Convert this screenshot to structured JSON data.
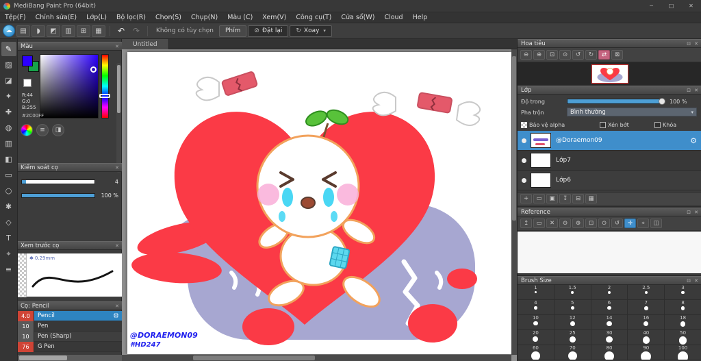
{
  "window": {
    "title": "MediBang Paint Pro (64bit)",
    "minimize_icon": "─",
    "maximize_icon": "□",
    "close_icon": "✕"
  },
  "menu": {
    "items": [
      "Tệp(F)",
      "Chỉnh sửa(E)",
      "Lớp(L)",
      "Bộ lọc(R)",
      "Chọn(S)",
      "Chụp(N)",
      "Màu (C)",
      "Xem(V)",
      "Công cụ(T)",
      "Cửa sổ(W)",
      "Cloud",
      "Help"
    ]
  },
  "toolbar": {
    "icons": [
      {
        "name": "cloud-sync-icon",
        "glyph": "☁",
        "cls": "cloud"
      },
      {
        "name": "new-canvas-icon",
        "glyph": "▤"
      },
      {
        "name": "comment-icon",
        "glyph": "◗"
      },
      {
        "name": "palette-icon",
        "glyph": "◩"
      },
      {
        "name": "panel-layout-icon",
        "glyph": "▥"
      },
      {
        "name": "grid-view-icon",
        "glyph": "⊞"
      },
      {
        "name": "material-icon",
        "glyph": "▦"
      }
    ],
    "undo_icon": "↶",
    "redo_icon": "↷",
    "no_option_label": "Không có tùy chọn",
    "keys_button": "Phím",
    "reset_icon": "⊘",
    "reset_button": "Đặt lại",
    "rotate_icon": "↻",
    "rotate_button": "Xoay",
    "rotate_caret": "▾"
  },
  "tools": [
    {
      "name": "pen-tool",
      "glyph": "✎"
    },
    {
      "name": "eraser-tool",
      "glyph": "▨"
    },
    {
      "name": "selection-pen-tool",
      "glyph": "◪"
    },
    {
      "name": "brush-tool",
      "glyph": "✦"
    },
    {
      "name": "move-tool",
      "glyph": "✚"
    },
    {
      "name": "fill-tool",
      "glyph": "◍"
    },
    {
      "name": "gradient-tool",
      "glyph": "▥"
    },
    {
      "name": "bucket-tool",
      "glyph": "◧"
    },
    {
      "name": "select-rect-tool",
      "glyph": "▭"
    },
    {
      "name": "lasso-tool",
      "glyph": "○"
    },
    {
      "name": "magic-wand-tool",
      "glyph": "✱"
    },
    {
      "name": "shape-tool",
      "glyph": "◇"
    },
    {
      "name": "text-tool",
      "glyph": "T"
    },
    {
      "name": "eyedropper-tool",
      "glyph": "⌖"
    },
    {
      "name": "hand-tool",
      "glyph": "≡"
    }
  ],
  "color_panel": {
    "title": "Màu",
    "r_label": "R:44",
    "g_label": "G:0",
    "b_label": "B:255",
    "hex_value": "#2C00FF",
    "foreground_color": "#2C00FF",
    "background_color": "#17a34a"
  },
  "brush_control": {
    "title": "Kiểm soát cọ",
    "size_value": "4",
    "opacity_value": "100 %"
  },
  "brush_preview": {
    "title": "Xem trước cọ",
    "width_marker": "✱",
    "width_label": "0.29mm"
  },
  "brush_list": {
    "title": "Cọ: Pencil",
    "settings_icon": "⚙",
    "items": [
      {
        "size": "4.0",
        "name": "Pencil",
        "selected": true,
        "red_badge": true
      },
      {
        "size": "10",
        "name": "Pen",
        "selected": false,
        "red_badge": false
      },
      {
        "size": "10",
        "name": "Pen (Sharp)",
        "selected": false,
        "red_badge": false
      },
      {
        "size": "76",
        "name": "G Pen",
        "selected": false,
        "red_badge": true
      }
    ]
  },
  "canvas": {
    "tab_label": "Untitled",
    "credit_line1": "@DORAEMON09",
    "credit_line2": "#HD247"
  },
  "navigator": {
    "title": "Hoa tiêu",
    "icons": [
      {
        "name": "zoom-out-icon",
        "glyph": "⊖"
      },
      {
        "name": "zoom-in-icon",
        "glyph": "⊕"
      },
      {
        "name": "fit-screen-icon",
        "glyph": "⊡"
      },
      {
        "name": "actual-size-icon",
        "glyph": "⊙"
      },
      {
        "name": "rotate-left-icon",
        "glyph": "↺"
      },
      {
        "name": "rotate-right-icon",
        "glyph": "↻"
      },
      {
        "name": "flip-horizontal-icon",
        "glyph": "⇄",
        "cls": "pink"
      },
      {
        "name": "reset-view-icon",
        "glyph": "⊠"
      }
    ]
  },
  "layers_panel": {
    "title": "Lớp",
    "opacity_label": "Độ trong",
    "opacity_value": "100 %",
    "blend_label": "Pha trộn",
    "blend_value": "Bình thường",
    "blend_caret": "▾",
    "alpha_lock_label": "Bảo vệ alpha",
    "clip_label": "Xén bớt",
    "lock_label": "Khóa",
    "settings_icon": "⚙",
    "layers": [
      {
        "name": "@Doraemon09",
        "selected": true
      },
      {
        "name": "Lớp7",
        "selected": false
      },
      {
        "name": "Lớp6",
        "selected": false
      }
    ],
    "buttons": [
      {
        "name": "add-layer-button",
        "glyph": "+"
      },
      {
        "name": "add-folder-button",
        "glyph": "▭"
      },
      {
        "name": "duplicate-layer-button",
        "glyph": "▣"
      },
      {
        "name": "merge-down-button",
        "glyph": "↧"
      },
      {
        "name": "transfer-layer-button",
        "glyph": "⊟"
      },
      {
        "name": "delete-layer-button",
        "glyph": "▦"
      }
    ]
  },
  "reference": {
    "title": "Reference",
    "icons": [
      {
        "name": "import-image-icon",
        "glyph": "↥"
      },
      {
        "name": "open-folder-icon",
        "glyph": "▭"
      },
      {
        "name": "clear-image-icon",
        "glyph": "✕"
      },
      {
        "name": "ref-zoom-out-icon",
        "glyph": "⊖"
      },
      {
        "name": "ref-zoom-in-icon",
        "glyph": "⊕"
      },
      {
        "name": "ref-fit-icon",
        "glyph": "⊡"
      },
      {
        "name": "ref-actual-size-icon",
        "glyph": "⊙"
      },
      {
        "name": "ref-rotate-icon",
        "glyph": "↺"
      },
      {
        "name": "ref-hand-icon",
        "glyph": "✛",
        "active": true
      },
      {
        "name": "ref-eyedropper-icon",
        "glyph": "⌖"
      },
      {
        "name": "ref-split-icon",
        "glyph": "◫"
      }
    ]
  },
  "brush_size": {
    "title": "Brush Size",
    "sizes": [
      "1",
      "1.5",
      "2",
      "2.5",
      "3",
      "4",
      "5",
      "6",
      "7",
      "8",
      "10",
      "12",
      "14",
      "16",
      "18",
      "20",
      "25",
      "30",
      "40",
      "50",
      "60",
      "70",
      "80",
      "90",
      "100"
    ]
  },
  "panel_icons": {
    "float_icon": "⊡",
    "close_icon": "✕"
  },
  "colors": {
    "accent_blue": "#3f8ecb",
    "slider_blue": "#4d9fd6",
    "badge_red": "#cf4436",
    "art_red": "#fb3a46",
    "art_purple": "#a7a7d1",
    "art_outline": "#f2a25c",
    "art_tear_cyan": "#49d7f4",
    "credit_blue": "#2222ee"
  }
}
